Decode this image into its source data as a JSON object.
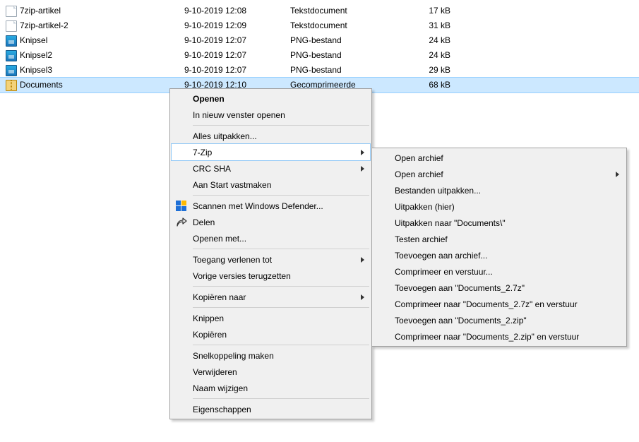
{
  "files": [
    {
      "name": "7zip-artikel",
      "date": "9-10-2019 12:08",
      "type": "Tekstdocument",
      "size": "17 kB",
      "icon": "txt",
      "selected": false
    },
    {
      "name": "7zip-artikel-2",
      "date": "9-10-2019 12:09",
      "type": "Tekstdocument",
      "size": "31 kB",
      "icon": "txt",
      "selected": false
    },
    {
      "name": "Knipsel",
      "date": "9-10-2019 12:07",
      "type": "PNG-bestand",
      "size": "24 kB",
      "icon": "png",
      "selected": false
    },
    {
      "name": "Knipsel2",
      "date": "9-10-2019 12:07",
      "type": "PNG-bestand",
      "size": "24 kB",
      "icon": "png",
      "selected": false
    },
    {
      "name": "Knipsel3",
      "date": "9-10-2019 12:07",
      "type": "PNG-bestand",
      "size": "29 kB",
      "icon": "png",
      "selected": false
    },
    {
      "name": "Documents",
      "date": "9-10-2019 12:10",
      "type": "Gecomprimeerde",
      "size": "68 kB",
      "icon": "zip",
      "selected": true
    }
  ],
  "menu1": [
    {
      "t": "item",
      "label": "Openen",
      "bold": true
    },
    {
      "t": "item",
      "label": "In nieuw venster openen"
    },
    {
      "t": "sep"
    },
    {
      "t": "item",
      "label": "Alles uitpakken..."
    },
    {
      "t": "item",
      "label": "7-Zip",
      "arrow": true,
      "hover": true
    },
    {
      "t": "item",
      "label": "CRC SHA",
      "arrow": true
    },
    {
      "t": "item",
      "label": "Aan Start vastmaken"
    },
    {
      "t": "sep"
    },
    {
      "t": "item",
      "label": "Scannen met Windows Defender...",
      "icon": "defender"
    },
    {
      "t": "item",
      "label": "Delen",
      "icon": "share"
    },
    {
      "t": "item",
      "label": "Openen met..."
    },
    {
      "t": "sep"
    },
    {
      "t": "item",
      "label": "Toegang verlenen tot",
      "arrow": true
    },
    {
      "t": "item",
      "label": "Vorige versies terugzetten"
    },
    {
      "t": "sep"
    },
    {
      "t": "item",
      "label": "Kopiëren naar",
      "arrow": true
    },
    {
      "t": "sep"
    },
    {
      "t": "item",
      "label": "Knippen"
    },
    {
      "t": "item",
      "label": "Kopiëren"
    },
    {
      "t": "sep"
    },
    {
      "t": "item",
      "label": "Snelkoppeling maken"
    },
    {
      "t": "item",
      "label": "Verwijderen"
    },
    {
      "t": "item",
      "label": "Naam wijzigen"
    },
    {
      "t": "sep"
    },
    {
      "t": "item",
      "label": "Eigenschappen"
    }
  ],
  "menu2": [
    {
      "t": "item",
      "label": "Open archief"
    },
    {
      "t": "item",
      "label": "Open archief",
      "arrow": true
    },
    {
      "t": "item",
      "label": "Bestanden uitpakken..."
    },
    {
      "t": "item",
      "label": "Uitpakken (hier)"
    },
    {
      "t": "item",
      "label": "Uitpakken naar \"Documents\\\""
    },
    {
      "t": "item",
      "label": "Testen archief"
    },
    {
      "t": "item",
      "label": "Toevoegen aan archief..."
    },
    {
      "t": "item",
      "label": "Comprimeer en verstuur..."
    },
    {
      "t": "item",
      "label": "Toevoegen aan \"Documents_2.7z\""
    },
    {
      "t": "item",
      "label": "Comprimeer naar \"Documents_2.7z\" en verstuur"
    },
    {
      "t": "item",
      "label": "Toevoegen aan \"Documents_2.zip\""
    },
    {
      "t": "item",
      "label": "Comprimeer naar \"Documents_2.zip\" en verstuur"
    }
  ]
}
